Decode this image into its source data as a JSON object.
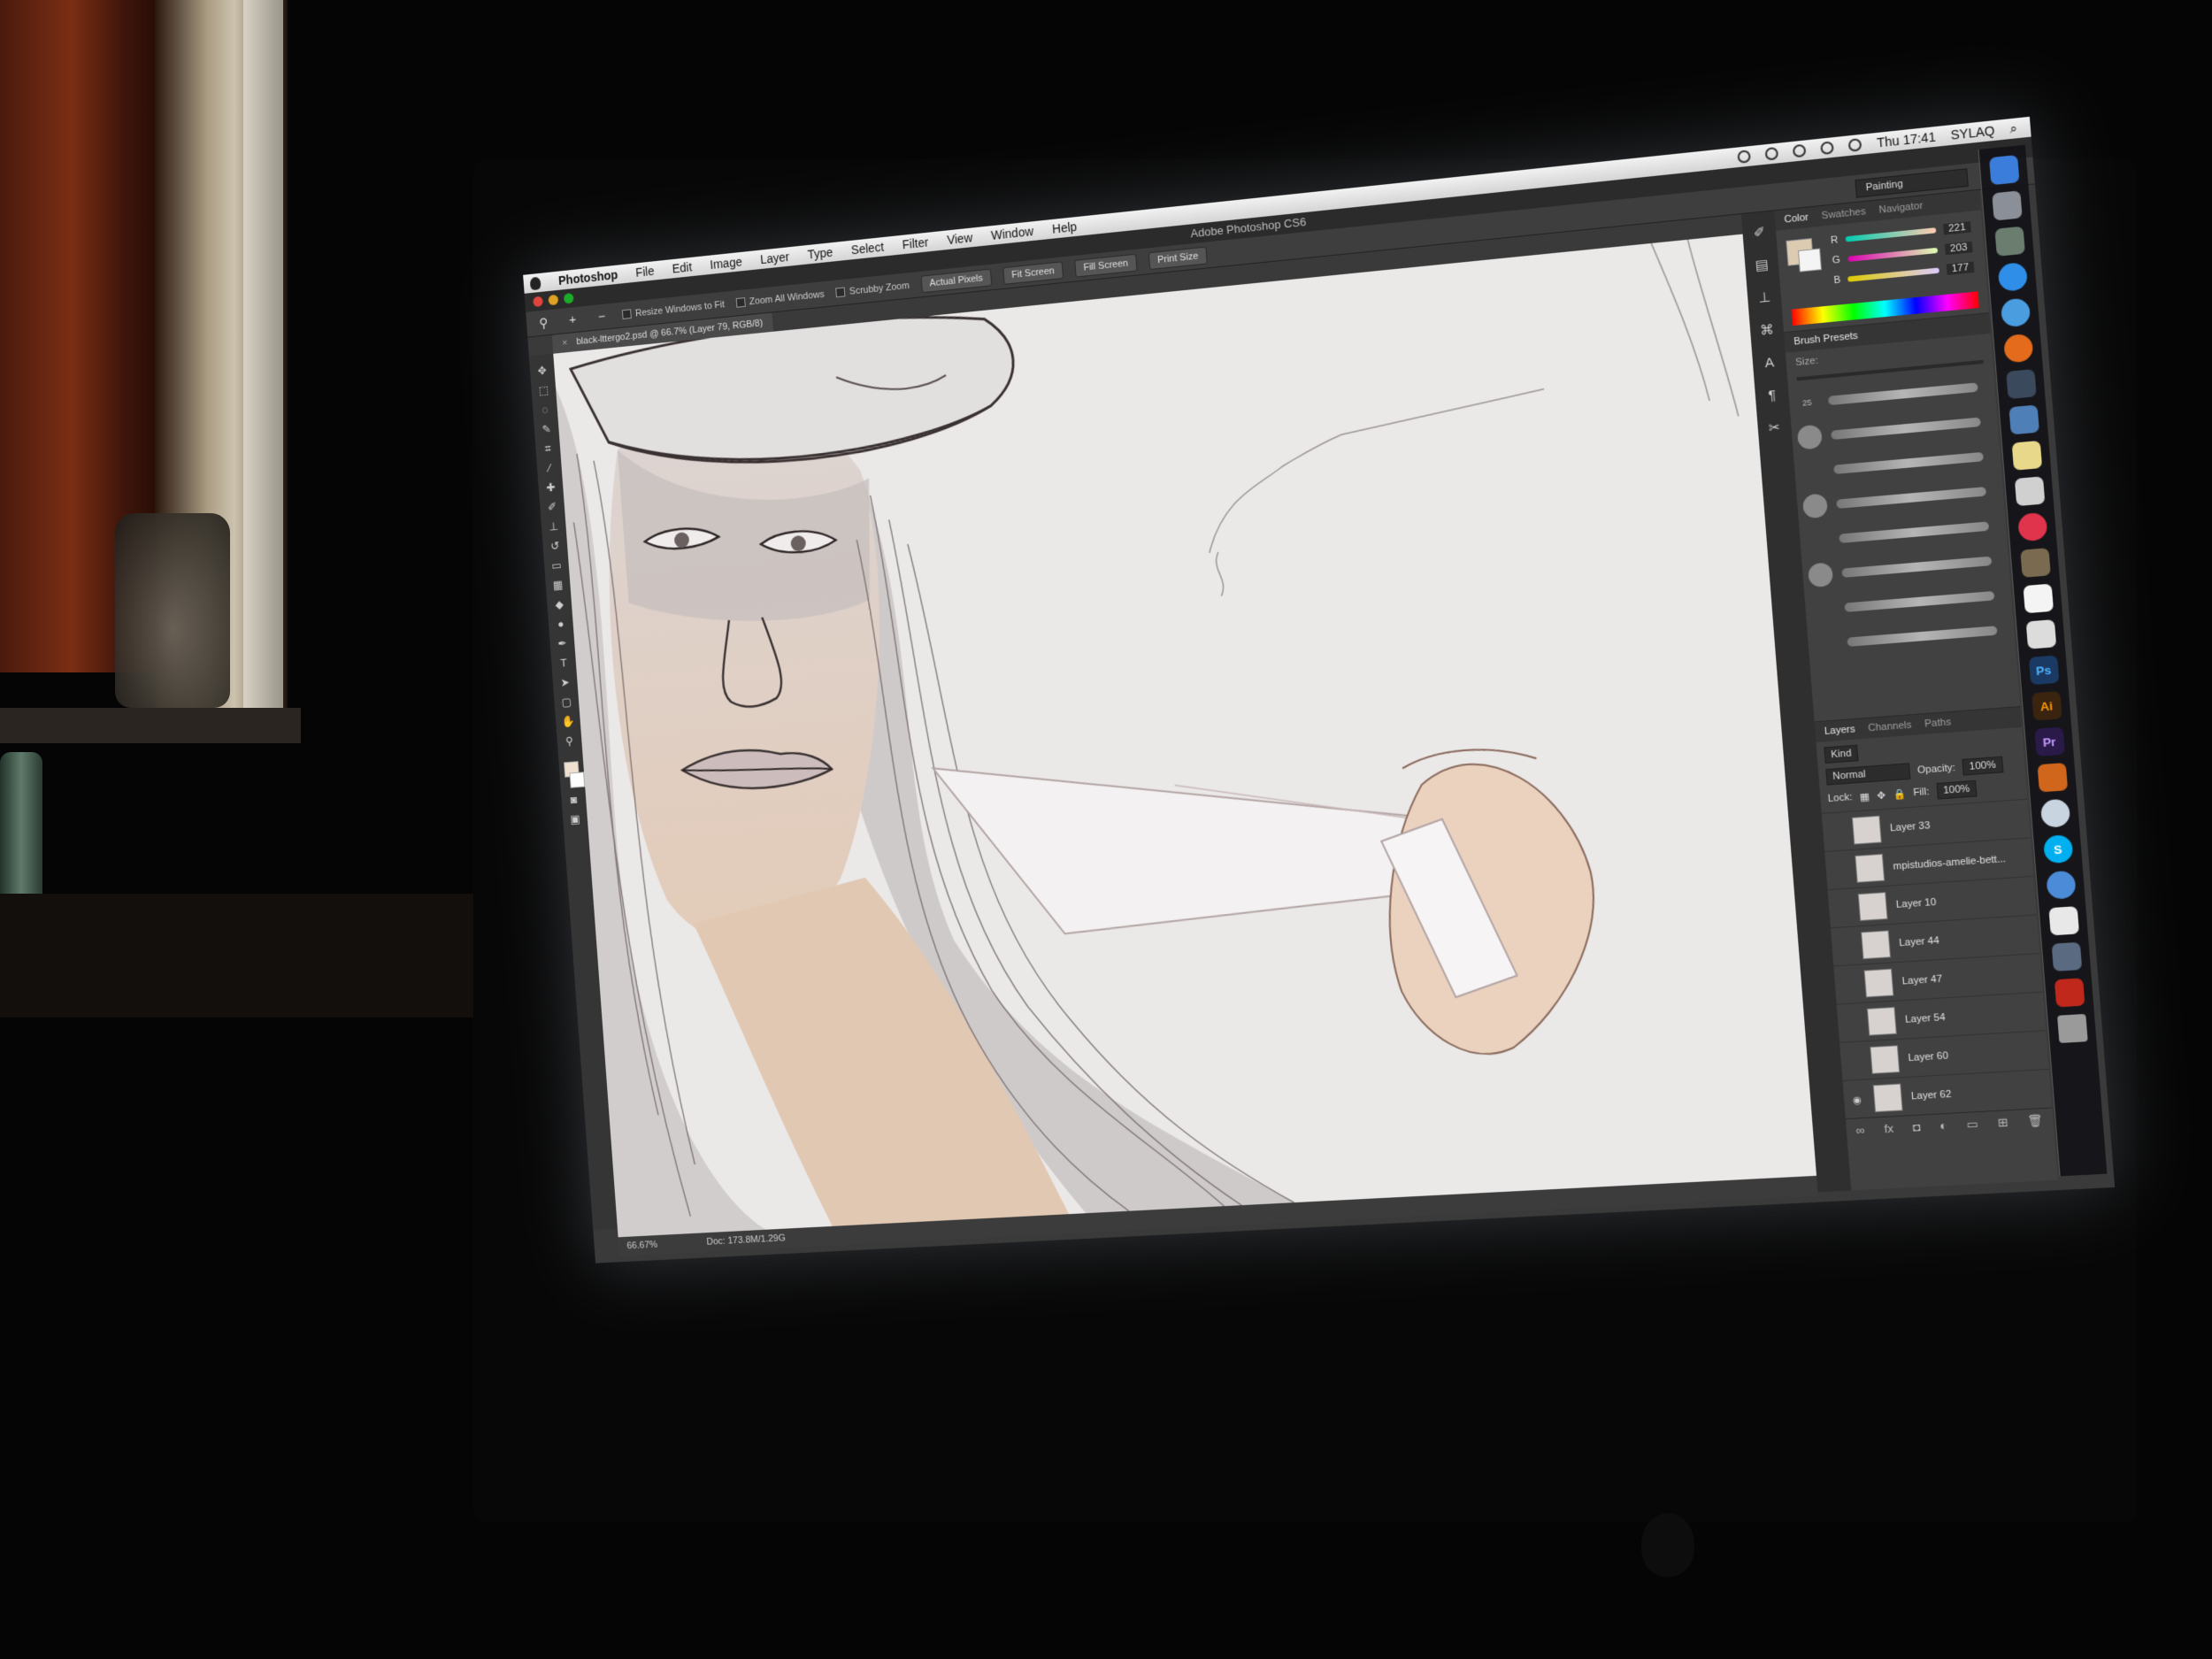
{
  "menubar": {
    "app_name": "Photoshop",
    "items": [
      "File",
      "Edit",
      "Image",
      "Layer",
      "Type",
      "Select",
      "Filter",
      "View",
      "Window",
      "Help"
    ],
    "clock": "Thu 17:41",
    "user": "SYLAQ"
  },
  "window": {
    "title": "Adobe Photoshop CS6"
  },
  "options": {
    "checks": [
      "Resize Windows to Fit",
      "Zoom All Windows",
      "Scrubby Zoom"
    ],
    "buttons": [
      "Actual Pixels",
      "Fit Screen",
      "Fill Screen",
      "Print Size"
    ],
    "workspace": "Painting"
  },
  "document": {
    "tab": "black-lttergo2.psd @ 66.7% (Layer 79, RGB/8)"
  },
  "status": {
    "zoom": "66.67%",
    "doc": "Doc: 173.8M/1.29G"
  },
  "color_panel": {
    "tabs": [
      "Color",
      "Swatches",
      "Navigator"
    ],
    "r_label": "R",
    "g_label": "G",
    "b_label": "B",
    "r": "221",
    "g": "203",
    "b": "177"
  },
  "brush_panel": {
    "title": "Brush Presets",
    "size_label": "Size:",
    "numbers": [
      "25",
      "",
      "",
      "",
      "",
      "",
      "",
      "",
      ""
    ]
  },
  "layers_panel": {
    "tabs": [
      "Layers",
      "Channels",
      "Paths"
    ],
    "kind": "Kind",
    "blend_mode": "Normal",
    "opacity_label": "Opacity:",
    "opacity": "100%",
    "lock_label": "Lock:",
    "fill_label": "Fill:",
    "fill": "100%",
    "layers": [
      "Layer 33",
      "mpistudios-amelie-bett...",
      "Layer 10",
      "Layer 44",
      "Layer 47",
      "Layer 54",
      "Layer 60",
      "Layer 62"
    ]
  },
  "dock_apps": [
    "Finder",
    "Launchpad",
    "Mission Control",
    "App Store",
    "Safari",
    "Firefox",
    "FaceTime",
    "Preview",
    "Notes",
    "iTunes",
    "Automator",
    "Calendar",
    "TextEdit",
    "Ps",
    "Ai",
    "Pr",
    "Keynote",
    "Chrome",
    "Skype",
    "Safari",
    "Documents",
    "Image Capture",
    "Photo Booth",
    "Trash"
  ]
}
